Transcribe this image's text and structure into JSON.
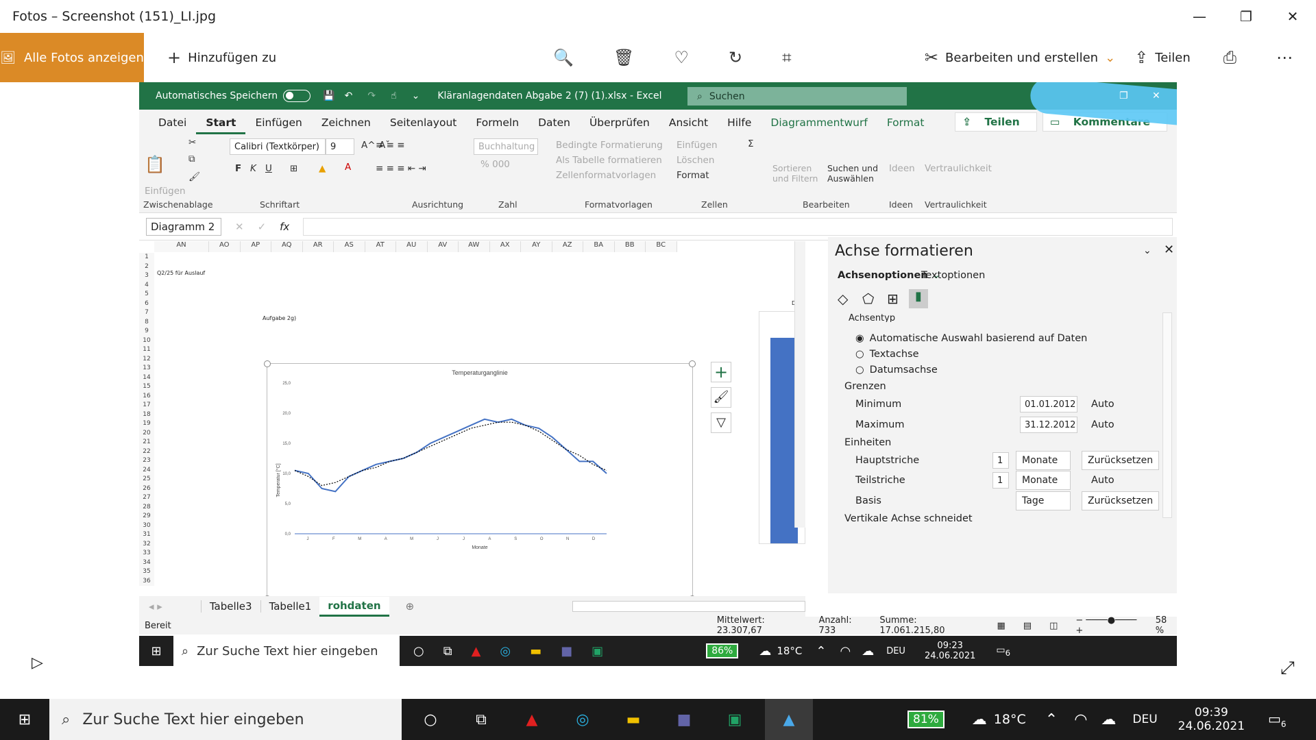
{
  "photos": {
    "title": "Fotos – Screenshot (151)_LI.jpg",
    "all_photos": "Alle Fotos anzeigen",
    "add_to": "Hinzufügen zu",
    "edit_create": "Bearbeiten und erstellen",
    "share": "Teilen"
  },
  "excel": {
    "autosave": "Automatisches Speichern",
    "filename": "Kläranlagendaten Abgabe 2 (7) (1).xlsx - Excel",
    "search": "Suchen",
    "tabs": [
      "Datei",
      "Start",
      "Einfügen",
      "Zeichnen",
      "Seitenlayout",
      "Formeln",
      "Daten",
      "Überprüfen",
      "Ansicht",
      "Hilfe",
      "Diagrammentwurf",
      "Format"
    ],
    "share": "Teilen",
    "comments": "Kommentare",
    "ribbon": {
      "paste": "Einfügen",
      "font": "Calibri (Textkörper)",
      "font_size": "9",
      "number_format": "Buchhaltung",
      "cond_format": "Bedingte Formatierung",
      "as_table": "Als Tabelle formatieren",
      "cell_styles": "Zellenformatvorlagen",
      "insert": "Einfügen",
      "delete": "Löschen",
      "format": "Format",
      "sort_filter": "Sortieren und Filtern",
      "find_select": "Suchen und Auswählen",
      "ideas": "Ideen",
      "sensitivity": "Vertraulichkeit",
      "groups": [
        "Zwischenablage",
        "Schriftart",
        "Ausrichtung",
        "Zahl",
        "Formatvorlagen",
        "Zellen",
        "Bearbeiten",
        "Ideen",
        "Vertraulichkeit"
      ]
    },
    "namebox": "Diagramm 2",
    "columns": [
      "AN",
      "AO",
      "AP",
      "AQ",
      "AR",
      "AS",
      "AT",
      "AU",
      "AV",
      "AW",
      "AX",
      "AY",
      "AZ",
      "BA",
      "BB",
      "BC"
    ],
    "rows": [
      "1",
      "2",
      "3",
      "4",
      "5",
      "6",
      "7",
      "8",
      "9",
      "10",
      "11",
      "12",
      "13",
      "14",
      "15",
      "16",
      "17",
      "18",
      "19",
      "20",
      "21",
      "22",
      "23",
      "24",
      "25",
      "26",
      "27",
      "28",
      "29",
      "30",
      "31",
      "32",
      "33",
      "34",
      "35",
      "36"
    ],
    "cell_text_row3": "Q2/25 für Auslauf",
    "cell_text_row8": "Aufgabe 2g)",
    "cell_text_dia": "Dia",
    "sheets": [
      "Tabelle3",
      "Tabelle1",
      "rohdaten"
    ],
    "status": {
      "ready": "Bereit",
      "average": "Mittelwert: 23.307,67",
      "count": "Anzahl: 733",
      "sum": "Summe: 17.061.215,80",
      "zoom": "58 %"
    },
    "panel": {
      "title": "Achse formatieren",
      "tab1": "Achsenoptionen",
      "tab2": "Textoptionen",
      "section_axis_type": "Achsentyp",
      "opt_auto": "Automatische Auswahl basierend auf Daten",
      "opt_text": "Textachse",
      "opt_date": "Datumsachse",
      "limits": "Grenzen",
      "minimum": "Minimum",
      "minimum_value": "01.01.2012",
      "maximum": "Maximum",
      "maximum_value": "31.12.2012",
      "auto": "Auto",
      "units": "Einheiten",
      "major": "Hauptstriche",
      "major_value": "1",
      "major_unit": "Monate",
      "minor": "Teilstriche",
      "minor_value": "1",
      "minor_unit": "Monate",
      "base": "Basis",
      "base_unit": "Tage",
      "reset": "Zurücksetzen",
      "vertical_cross": "Vertikale Achse schneidet"
    },
    "inner_taskbar": {
      "search": "Zur Suche Text hier eingeben",
      "battery": "86%",
      "temp": "18°C",
      "lang": "DEU",
      "time": "09:23",
      "date": "24.06.2021",
      "notif": "6"
    }
  },
  "chart_data": {
    "type": "line",
    "title": "Temperaturganglinie",
    "xlabel": "Monate",
    "ylabel": "Temperatur [°C]",
    "ylim": [
      0,
      25
    ],
    "yticks": [
      "25,0",
      "20,0",
      "15,0",
      "10,0",
      "5,0",
      "0,0"
    ],
    "categories": [
      "J",
      "F",
      "M",
      "A",
      "M",
      "J",
      "J",
      "A",
      "S",
      "O",
      "N",
      "D"
    ],
    "series": [
      {
        "values": [
          10.5,
          10.0,
          7.5,
          7.0,
          9.5,
          10.5,
          11.5,
          12.0,
          12.5,
          13.5,
          15.0,
          16.0,
          17.0,
          18.0,
          19.0,
          18.5,
          19.0,
          18.0,
          17.5,
          16.0,
          14.0,
          12.0,
          12.0,
          10.0
        ]
      },
      {
        "values": [
          10.5,
          9.5,
          8.0,
          8.5,
          9.5,
          10.5,
          11.0,
          12.0,
          12.5,
          13.5,
          14.5,
          15.5,
          16.5,
          17.5,
          18.0,
          18.5,
          18.5,
          18.0,
          17.0,
          15.5,
          14.0,
          13.0,
          11.5,
          10.5
        ]
      }
    ],
    "colors": {
      "series1": "#4472c4",
      "series2": "#000000"
    }
  },
  "taskbar": {
    "search": "Zur Suche Text hier eingeben",
    "battery": "81%",
    "temp": "18°C",
    "lang": "DEU",
    "time": "09:39",
    "date": "24.06.2021",
    "notif": "6"
  }
}
